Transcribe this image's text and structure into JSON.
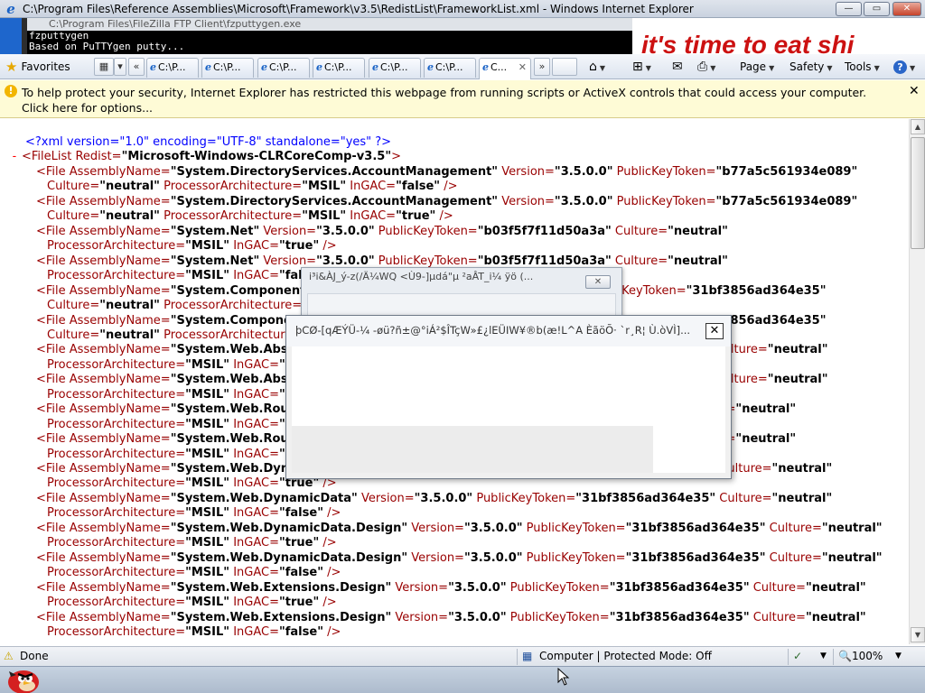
{
  "window": {
    "title": "C:\\Program Files\\Reference Assemblies\\Microsoft\\Framework\\v3.5\\RedistList\\FrameworkList.xml - Windows Internet Explorer",
    "minimize_glyph": "—",
    "maximize_glyph": "▭",
    "close_glyph": "✕"
  },
  "background_window": {
    "cmd_title": "C:\\Program Files\\FileZilla FTP Client\\fzputtygen.exe",
    "cmd_line1": "fzputtygen",
    "cmd_line2": "Based on PuTTYgen putty...",
    "banner_text": "it's time to eat shi"
  },
  "command_bar": {
    "favorites_label": "Favorites",
    "tabs": [
      {
        "label": "C:\\P..."
      },
      {
        "label": "C:\\P..."
      },
      {
        "label": "C:\\P..."
      },
      {
        "label": "C:\\P..."
      },
      {
        "label": "C:\\P..."
      },
      {
        "label": "C:\\P..."
      },
      {
        "label": "C..."
      }
    ],
    "page_label": "Page",
    "safety_label": "Safety",
    "tools_label": "Tools",
    "help_glyph": "?"
  },
  "infobar": {
    "message": "To help protect your security, Internet Explorer has restricted this webpage from running scripts or ActiveX controls that could access your computer. Click here for options..."
  },
  "xml": {
    "declaration": "<?xml version=\"1.0\" encoding=\"UTF-8\" standalone=\"yes\" ?>",
    "root_minus": "-",
    "root_open": "<FileList",
    "root_attr": " Redist=",
    "root_val": "\"Microsoft-Windows-CLRCoreComp-v3.5\"",
    "root_close": ">",
    "lines": [
      [
        {
          "c": "tag",
          "t": "<File "
        },
        {
          "c": "attr",
          "t": "AssemblyName="
        },
        {
          "c": "val",
          "t": "\"System.DirectoryServices.AccountManagement\""
        },
        {
          "c": "attr",
          "t": " Version="
        },
        {
          "c": "val",
          "t": "\"3.5.0.0\""
        },
        {
          "c": "attr",
          "t": " PublicKeyToken="
        },
        {
          "c": "val",
          "t": "\"b77a5c561934e089\""
        }
      ],
      [
        {
          "c": "attr",
          "t": "Culture="
        },
        {
          "c": "val",
          "t": "\"neutral\""
        },
        {
          "c": "attr",
          "t": " ProcessorArchitecture="
        },
        {
          "c": "val",
          "t": "\"MSIL\""
        },
        {
          "c": "attr",
          "t": " InGAC="
        },
        {
          "c": "val",
          "t": "\"false\""
        },
        {
          "c": "tag",
          "t": " />"
        }
      ],
      [
        {
          "c": "tag",
          "t": "<File "
        },
        {
          "c": "attr",
          "t": "AssemblyName="
        },
        {
          "c": "val",
          "t": "\"System.DirectoryServices.AccountManagement\""
        },
        {
          "c": "attr",
          "t": " Version="
        },
        {
          "c": "val",
          "t": "\"3.5.0.0\""
        },
        {
          "c": "attr",
          "t": " PublicKeyToken="
        },
        {
          "c": "val",
          "t": "\"b77a5c561934e089\""
        }
      ],
      [
        {
          "c": "attr",
          "t": "Culture="
        },
        {
          "c": "val",
          "t": "\"neutral\""
        },
        {
          "c": "attr",
          "t": " ProcessorArchitecture="
        },
        {
          "c": "val",
          "t": "\"MSIL\""
        },
        {
          "c": "attr",
          "t": " InGAC="
        },
        {
          "c": "val",
          "t": "\"true\""
        },
        {
          "c": "tag",
          "t": " />"
        }
      ],
      [
        {
          "c": "tag",
          "t": "<File "
        },
        {
          "c": "attr",
          "t": "AssemblyName="
        },
        {
          "c": "val",
          "t": "\"System.Net\""
        },
        {
          "c": "attr",
          "t": " Version="
        },
        {
          "c": "val",
          "t": "\"3.5.0.0\""
        },
        {
          "c": "attr",
          "t": " PublicKeyToken="
        },
        {
          "c": "val",
          "t": "\"b03f5f7f11d50a3a\""
        },
        {
          "c": "attr",
          "t": " Culture="
        },
        {
          "c": "val",
          "t": "\"neutral\""
        }
      ],
      [
        {
          "c": "attr",
          "t": "ProcessorArchitecture="
        },
        {
          "c": "val",
          "t": "\"MSIL\""
        },
        {
          "c": "attr",
          "t": " InGAC="
        },
        {
          "c": "val",
          "t": "\"true\""
        },
        {
          "c": "tag",
          "t": " />"
        }
      ],
      [
        {
          "c": "tag",
          "t": "<File "
        },
        {
          "c": "attr",
          "t": "AssemblyName="
        },
        {
          "c": "val",
          "t": "\"System.Net\""
        },
        {
          "c": "attr",
          "t": " Version="
        },
        {
          "c": "val",
          "t": "\"3.5.0.0\""
        },
        {
          "c": "attr",
          "t": " PublicKeyToken="
        },
        {
          "c": "val",
          "t": "\"b03f5f7f11d50a3a\""
        },
        {
          "c": "attr",
          "t": " Culture="
        },
        {
          "c": "val",
          "t": "\"neutral\""
        }
      ],
      [
        {
          "c": "attr",
          "t": "ProcessorArchitecture="
        },
        {
          "c": "val",
          "t": "\"MSIL\""
        },
        {
          "c": "attr",
          "t": " InGAC="
        },
        {
          "c": "val",
          "t": "\"false\""
        },
        {
          "c": "tag",
          "t": " />"
        }
      ],
      [
        {
          "c": "tag",
          "t": "<File "
        },
        {
          "c": "attr",
          "t": "AssemblyName="
        },
        {
          "c": "val",
          "t": "\"System.ComponentModel.DataAnnotations\""
        },
        {
          "c": "attr",
          "t": " Version="
        },
        {
          "c": "val",
          "t": "\"3.5.0.0\""
        },
        {
          "c": "attr",
          "t": " PublicKeyToken="
        },
        {
          "c": "val",
          "t": "\"31bf3856ad364e35\""
        }
      ],
      [
        {
          "c": "attr",
          "t": "Culture="
        },
        {
          "c": "val",
          "t": "\"neutral\""
        },
        {
          "c": "attr",
          "t": " ProcessorArchitecture="
        },
        {
          "c": "val",
          "t": "\"MSIL\""
        },
        {
          "c": "attr",
          "t": " InGAC="
        },
        {
          "c": "val",
          "t": "\"true\""
        },
        {
          "c": "tag",
          "t": " />"
        }
      ],
      [
        {
          "c": "tag",
          "t": "<File "
        },
        {
          "c": "attr",
          "t": "AssemblyName="
        },
        {
          "c": "val",
          "t": "\"System.ComponentModel.DataAnnotations\""
        },
        {
          "c": "attr",
          "t": " Version="
        },
        {
          "c": "val",
          "t": "\"3.5.0.0\""
        },
        {
          "c": "attr",
          "t": " PublicKeyToken="
        },
        {
          "c": "val",
          "t": "\"31bf3856ad364e35\""
        }
      ],
      [
        {
          "c": "attr",
          "t": "Culture="
        },
        {
          "c": "val",
          "t": "\"neutral\""
        },
        {
          "c": "attr",
          "t": " ProcessorArchitecture="
        },
        {
          "c": "val",
          "t": "\"MSIL\""
        },
        {
          "c": "attr",
          "t": " InGAC="
        },
        {
          "c": "val",
          "t": "\"false\""
        },
        {
          "c": "tag",
          "t": " />"
        }
      ],
      [
        {
          "c": "tag",
          "t": "<File "
        },
        {
          "c": "attr",
          "t": "AssemblyName="
        },
        {
          "c": "val",
          "t": "\"System.Web.Abstractions\""
        },
        {
          "c": "attr",
          "t": " Version="
        },
        {
          "c": "val",
          "t": "\"3.5.0.0\""
        },
        {
          "c": "attr",
          "t": " PublicKeyToken="
        },
        {
          "c": "val",
          "t": "\"31bf3856ad364e35\""
        },
        {
          "c": "attr",
          "t": " Culture="
        },
        {
          "c": "val",
          "t": "\"neutral\""
        }
      ],
      [
        {
          "c": "attr",
          "t": "ProcessorArchitecture="
        },
        {
          "c": "val",
          "t": "\"MSIL\""
        },
        {
          "c": "attr",
          "t": " InGAC="
        },
        {
          "c": "val",
          "t": "\"true\""
        },
        {
          "c": "tag",
          "t": " />"
        }
      ],
      [
        {
          "c": "tag",
          "t": "<File "
        },
        {
          "c": "attr",
          "t": "AssemblyName="
        },
        {
          "c": "val",
          "t": "\"System.Web.Abstractions\""
        },
        {
          "c": "attr",
          "t": " Version="
        },
        {
          "c": "val",
          "t": "\"3.5.0.0\""
        },
        {
          "c": "attr",
          "t": " PublicKeyToken="
        },
        {
          "c": "val",
          "t": "\"31bf3856ad364e35\""
        },
        {
          "c": "attr",
          "t": " Culture="
        },
        {
          "c": "val",
          "t": "\"neutral\""
        }
      ],
      [
        {
          "c": "attr",
          "t": "ProcessorArchitecture="
        },
        {
          "c": "val",
          "t": "\"MSIL\""
        },
        {
          "c": "attr",
          "t": " InGAC="
        },
        {
          "c": "val",
          "t": "\"false\""
        },
        {
          "c": "tag",
          "t": " />"
        }
      ],
      [
        {
          "c": "tag",
          "t": "<File "
        },
        {
          "c": "attr",
          "t": "AssemblyName="
        },
        {
          "c": "val",
          "t": "\"System.Web.Routing\""
        },
        {
          "c": "attr",
          "t": " Version="
        },
        {
          "c": "val",
          "t": "\"3.5.0.0\""
        },
        {
          "c": "attr",
          "t": " PublicKeyToken="
        },
        {
          "c": "val",
          "t": "\"31bf3856ad364e35\""
        },
        {
          "c": "attr",
          "t": " Culture="
        },
        {
          "c": "val",
          "t": "\"neutral\""
        }
      ],
      [
        {
          "c": "attr",
          "t": "ProcessorArchitecture="
        },
        {
          "c": "val",
          "t": "\"MSIL\""
        },
        {
          "c": "attr",
          "t": " InGAC="
        },
        {
          "c": "val",
          "t": "\"true\""
        },
        {
          "c": "tag",
          "t": " />"
        }
      ],
      [
        {
          "c": "tag",
          "t": "<File "
        },
        {
          "c": "attr",
          "t": "AssemblyName="
        },
        {
          "c": "val",
          "t": "\"System.Web.Routing\""
        },
        {
          "c": "attr",
          "t": " Version="
        },
        {
          "c": "val",
          "t": "\"3.5.0.0\""
        },
        {
          "c": "attr",
          "t": " PublicKeyToken="
        },
        {
          "c": "val",
          "t": "\"31bf3856ad364e35\""
        },
        {
          "c": "attr",
          "t": " Culture="
        },
        {
          "c": "val",
          "t": "\"neutral\""
        }
      ],
      [
        {
          "c": "attr",
          "t": "ProcessorArchitecture="
        },
        {
          "c": "val",
          "t": "\"MSIL\""
        },
        {
          "c": "attr",
          "t": " InGAC="
        },
        {
          "c": "val",
          "t": "\"false\""
        },
        {
          "c": "tag",
          "t": " />"
        }
      ],
      [
        {
          "c": "tag",
          "t": "<File "
        },
        {
          "c": "attr",
          "t": "AssemblyName="
        },
        {
          "c": "val",
          "t": "\"System.Web.DynamicData\""
        },
        {
          "c": "attr",
          "t": " Version="
        },
        {
          "c": "val",
          "t": "\"3.5.0.0\""
        },
        {
          "c": "attr",
          "t": " PublicKeyToken="
        },
        {
          "c": "val",
          "t": "\"31bf3856ad364e35\""
        },
        {
          "c": "attr",
          "t": " Culture="
        },
        {
          "c": "val",
          "t": "\"neutral\""
        }
      ],
      [
        {
          "c": "attr",
          "t": "ProcessorArchitecture="
        },
        {
          "c": "val",
          "t": "\"MSIL\""
        },
        {
          "c": "attr",
          "t": " InGAC="
        },
        {
          "c": "val",
          "t": "\"true\""
        },
        {
          "c": "tag",
          "t": " />"
        }
      ],
      [
        {
          "c": "tag",
          "t": "<File "
        },
        {
          "c": "attr",
          "t": "AssemblyName="
        },
        {
          "c": "val",
          "t": "\"System.Web.DynamicData\""
        },
        {
          "c": "attr",
          "t": " Version="
        },
        {
          "c": "val",
          "t": "\"3.5.0.0\""
        },
        {
          "c": "attr",
          "t": " PublicKeyToken="
        },
        {
          "c": "val",
          "t": "\"31bf3856ad364e35\""
        },
        {
          "c": "attr",
          "t": " Culture="
        },
        {
          "c": "val",
          "t": "\"neutral\""
        }
      ],
      [
        {
          "c": "attr",
          "t": "ProcessorArchitecture="
        },
        {
          "c": "val",
          "t": "\"MSIL\""
        },
        {
          "c": "attr",
          "t": " InGAC="
        },
        {
          "c": "val",
          "t": "\"false\""
        },
        {
          "c": "tag",
          "t": " />"
        }
      ],
      [
        {
          "c": "tag",
          "t": "<File "
        },
        {
          "c": "attr",
          "t": "AssemblyName="
        },
        {
          "c": "val",
          "t": "\"System.Web.DynamicData.Design\""
        },
        {
          "c": "attr",
          "t": " Version="
        },
        {
          "c": "val",
          "t": "\"3.5.0.0\""
        },
        {
          "c": "attr",
          "t": " PublicKeyToken="
        },
        {
          "c": "val",
          "t": "\"31bf3856ad364e35\""
        },
        {
          "c": "attr",
          "t": " Culture="
        },
        {
          "c": "val",
          "t": "\"neutral\""
        }
      ],
      [
        {
          "c": "attr",
          "t": "ProcessorArchitecture="
        },
        {
          "c": "val",
          "t": "\"MSIL\""
        },
        {
          "c": "attr",
          "t": " InGAC="
        },
        {
          "c": "val",
          "t": "\"true\""
        },
        {
          "c": "tag",
          "t": " />"
        }
      ],
      [
        {
          "c": "tag",
          "t": "<File "
        },
        {
          "c": "attr",
          "t": "AssemblyName="
        },
        {
          "c": "val",
          "t": "\"System.Web.DynamicData.Design\""
        },
        {
          "c": "attr",
          "t": " Version="
        },
        {
          "c": "val",
          "t": "\"3.5.0.0\""
        },
        {
          "c": "attr",
          "t": " PublicKeyToken="
        },
        {
          "c": "val",
          "t": "\"31bf3856ad364e35\""
        },
        {
          "c": "attr",
          "t": " Culture="
        },
        {
          "c": "val",
          "t": "\"neutral\""
        }
      ],
      [
        {
          "c": "attr",
          "t": "ProcessorArchitecture="
        },
        {
          "c": "val",
          "t": "\"MSIL\""
        },
        {
          "c": "attr",
          "t": " InGAC="
        },
        {
          "c": "val",
          "t": "\"false\""
        },
        {
          "c": "tag",
          "t": " />"
        }
      ],
      [
        {
          "c": "tag",
          "t": "<File "
        },
        {
          "c": "attr",
          "t": "AssemblyName="
        },
        {
          "c": "val",
          "t": "\"System.Web.Extensions.Design\""
        },
        {
          "c": "attr",
          "t": " Version="
        },
        {
          "c": "val",
          "t": "\"3.5.0.0\""
        },
        {
          "c": "attr",
          "t": " PublicKeyToken="
        },
        {
          "c": "val",
          "t": "\"31bf3856ad364e35\""
        },
        {
          "c": "attr",
          "t": " Culture="
        },
        {
          "c": "val",
          "t": "\"neutral\""
        }
      ],
      [
        {
          "c": "attr",
          "t": "ProcessorArchitecture="
        },
        {
          "c": "val",
          "t": "\"MSIL\""
        },
        {
          "c": "attr",
          "t": " InGAC="
        },
        {
          "c": "val",
          "t": "\"true\""
        },
        {
          "c": "tag",
          "t": " />"
        }
      ],
      [
        {
          "c": "tag",
          "t": "<File "
        },
        {
          "c": "attr",
          "t": "AssemblyName="
        },
        {
          "c": "val",
          "t": "\"System.Web.Extensions.Design\""
        },
        {
          "c": "attr",
          "t": " Version="
        },
        {
          "c": "val",
          "t": "\"3.5.0.0\""
        },
        {
          "c": "attr",
          "t": " PublicKeyToken="
        },
        {
          "c": "val",
          "t": "\"31bf3856ad364e35\""
        },
        {
          "c": "attr",
          "t": " Culture="
        },
        {
          "c": "val",
          "t": "\"neutral\""
        }
      ],
      [
        {
          "c": "attr",
          "t": "ProcessorArchitecture="
        },
        {
          "c": "val",
          "t": "\"MSIL\""
        },
        {
          "c": "attr",
          "t": " InGAC="
        },
        {
          "c": "val",
          "t": "\"false\""
        },
        {
          "c": "tag",
          "t": " />"
        }
      ]
    ]
  },
  "dialog_back": {
    "title": "i³i&ÀJ_ý-z(/Ä¼WQ <Ù9-]µdá\"µ ²aÂT_i¼ ÿö (...",
    "close_glyph": "✕"
  },
  "dialog_front": {
    "title": "þCØ-[qÆÝÜ-¼ -øü?ñ±@°iÁ²$ÎTçW»£¿lEÜIW¥®b(æ!L^A ÈãöÕ· `r¸R¦ Ù.òVÌ]...",
    "close_glyph": "✕"
  },
  "status_bar": {
    "status": "Done",
    "zone": "Computer | Protected Mode: Off",
    "zoom": "100%"
  }
}
